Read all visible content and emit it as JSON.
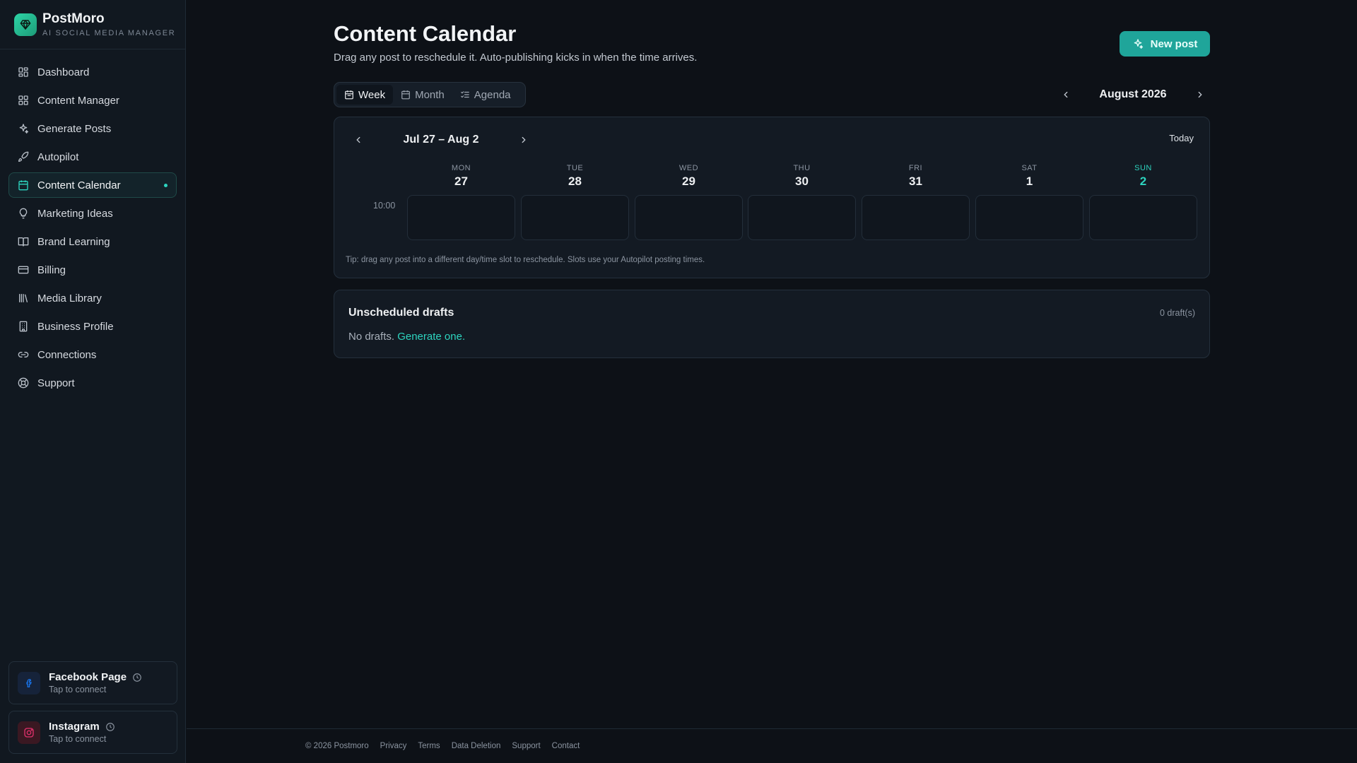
{
  "brand": {
    "name": "PostMoro",
    "tagline": "AI SOCIAL MEDIA MANAGER"
  },
  "sidebar": {
    "items": [
      {
        "label": "Dashboard",
        "icon": "grid-icon"
      },
      {
        "label": "Content Manager",
        "icon": "grid-icon"
      },
      {
        "label": "Generate Posts",
        "icon": "sparkles-icon"
      },
      {
        "label": "Autopilot",
        "icon": "rocket-icon"
      },
      {
        "label": "Content Calendar",
        "icon": "calendar-icon",
        "active": true
      },
      {
        "label": "Marketing Ideas",
        "icon": "lightbulb-icon"
      },
      {
        "label": "Brand Learning",
        "icon": "book-icon"
      },
      {
        "label": "Billing",
        "icon": "credit-card-icon"
      },
      {
        "label": "Media Library",
        "icon": "library-icon"
      },
      {
        "label": "Business Profile",
        "icon": "building-icon"
      },
      {
        "label": "Connections",
        "icon": "link-icon"
      },
      {
        "label": "Support",
        "icon": "lifebuoy-icon"
      }
    ],
    "connections": [
      {
        "title": "Facebook Page",
        "subtitle": "Tap to connect",
        "icon": "facebook-icon",
        "color": "#1877f2"
      },
      {
        "title": "Instagram",
        "subtitle": "Tap to connect",
        "icon": "instagram-icon",
        "color": "#e1306c"
      }
    ]
  },
  "header": {
    "title": "Content Calendar",
    "subtitle": "Drag any post to reschedule it. Auto-publishing kicks in when the time arrives.",
    "new_post_label": "New post"
  },
  "views": {
    "week": "Week",
    "month": "Month",
    "agenda": "Agenda",
    "active": "Week"
  },
  "month_label": "August 2026",
  "calendar": {
    "range_label": "Jul 27 – Aug 2",
    "today_label": "Today",
    "days": [
      {
        "name": "MON",
        "num": "27"
      },
      {
        "name": "TUE",
        "num": "28"
      },
      {
        "name": "WED",
        "num": "29"
      },
      {
        "name": "THU",
        "num": "30"
      },
      {
        "name": "FRI",
        "num": "31"
      },
      {
        "name": "SAT",
        "num": "1"
      },
      {
        "name": "SUN",
        "num": "2",
        "today": true
      }
    ],
    "time_slot": "10:00",
    "tip": "Tip: drag any post into a different day/time slot to reschedule. Slots use your Autopilot posting times."
  },
  "drafts": {
    "title": "Unscheduled drafts",
    "count": "0 draft(s)",
    "empty_text": "No drafts.",
    "empty_link": "Generate one."
  },
  "footer": {
    "copyright": "© 2026 Postmoro",
    "links": [
      "Privacy",
      "Terms",
      "Data Deletion",
      "Support",
      "Contact"
    ]
  },
  "colors": {
    "accent": "#2dd4bf",
    "button": "#1fa59a",
    "background": "#0d1117"
  }
}
